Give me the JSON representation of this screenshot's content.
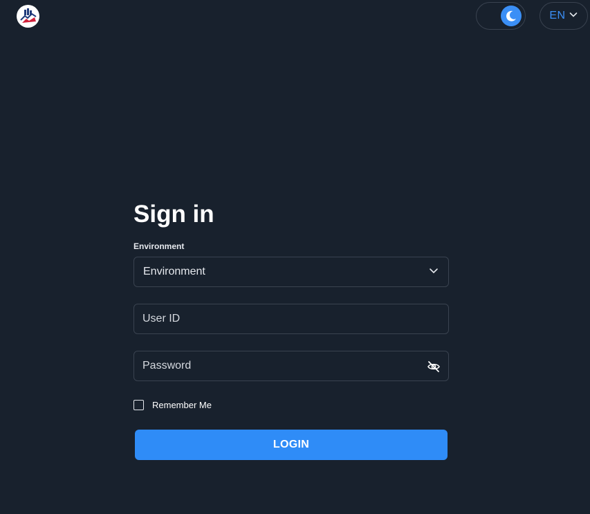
{
  "header": {
    "logo_icon": "company-logo-icon",
    "theme_toggle": {
      "icon": "moon-icon",
      "mode": "dark",
      "accent": "#3b8ff6"
    },
    "language": {
      "value": "EN",
      "icon": "chevron-down-icon"
    }
  },
  "form": {
    "title": "Sign in",
    "environment_label": "Environment",
    "environment_value": "Environment",
    "user_id_placeholder": "User ID",
    "password_placeholder": "Password",
    "password_toggle_icon": "eye-off-icon",
    "remember_label": "Remember Me",
    "login_label": "LOGIN"
  },
  "colors": {
    "background": "#18212d",
    "border": "#3a4350",
    "primary": "#2f8cf7"
  }
}
